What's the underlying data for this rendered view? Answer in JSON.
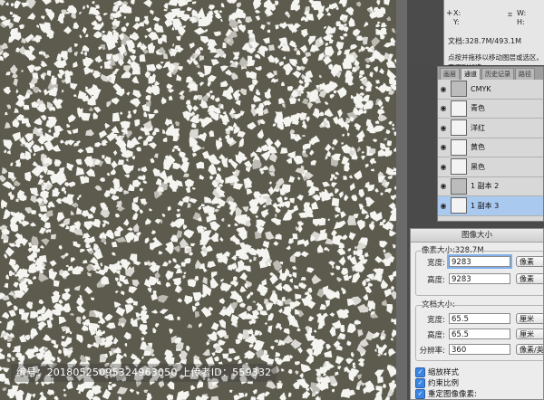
{
  "watermark": "编号：20180525095324963050 上传者ID：559332",
  "info": {
    "x_label": "X:",
    "y_label": "Y:",
    "w_label": "W:",
    "h_label": "H:",
    "doc_size": "文档:328.7M/493.1M",
    "tip": "点按并拖移以移动图层或选区。要用附加选..."
  },
  "channels": {
    "tabs": [
      "画层",
      "通道",
      "历史记录",
      "路径"
    ],
    "active_tab": "通道",
    "items": [
      {
        "label": "CMYK",
        "selected": false
      },
      {
        "label": "青色",
        "selected": false
      },
      {
        "label": "洋红",
        "selected": false
      },
      {
        "label": "黄色",
        "selected": false
      },
      {
        "label": "黑色",
        "selected": false
      },
      {
        "label": "1 副本 2",
        "selected": false
      },
      {
        "label": "1 副本 3",
        "selected": true
      }
    ]
  },
  "dialog": {
    "title": "图像大小",
    "pixel_size": "像素大小:328.7M",
    "width_label": "宽度:",
    "width_value": "9283",
    "width_unit": "像素",
    "height_label": "高度:",
    "height_value": "9283",
    "height_unit": "像素",
    "doc_size": "文档大小:",
    "doc_width_label": "宽度:",
    "doc_width_value": "65.5",
    "doc_width_unit": "厘米",
    "doc_height_label": "高度:",
    "doc_height_value": "65.5",
    "doc_height_unit": "厘米",
    "res_label": "分辨率:",
    "res_value": "360",
    "res_unit": "像素/英寸",
    "scale_styles": "缩放样式",
    "constrain": "约束比例",
    "resample": "重定图像像素:"
  },
  "colors": {
    "canvas_bg": "#5d5a4e",
    "stone": "#f4f4f0",
    "selected_row": "#a9c9ef",
    "checkbox": "#3b86e0"
  }
}
